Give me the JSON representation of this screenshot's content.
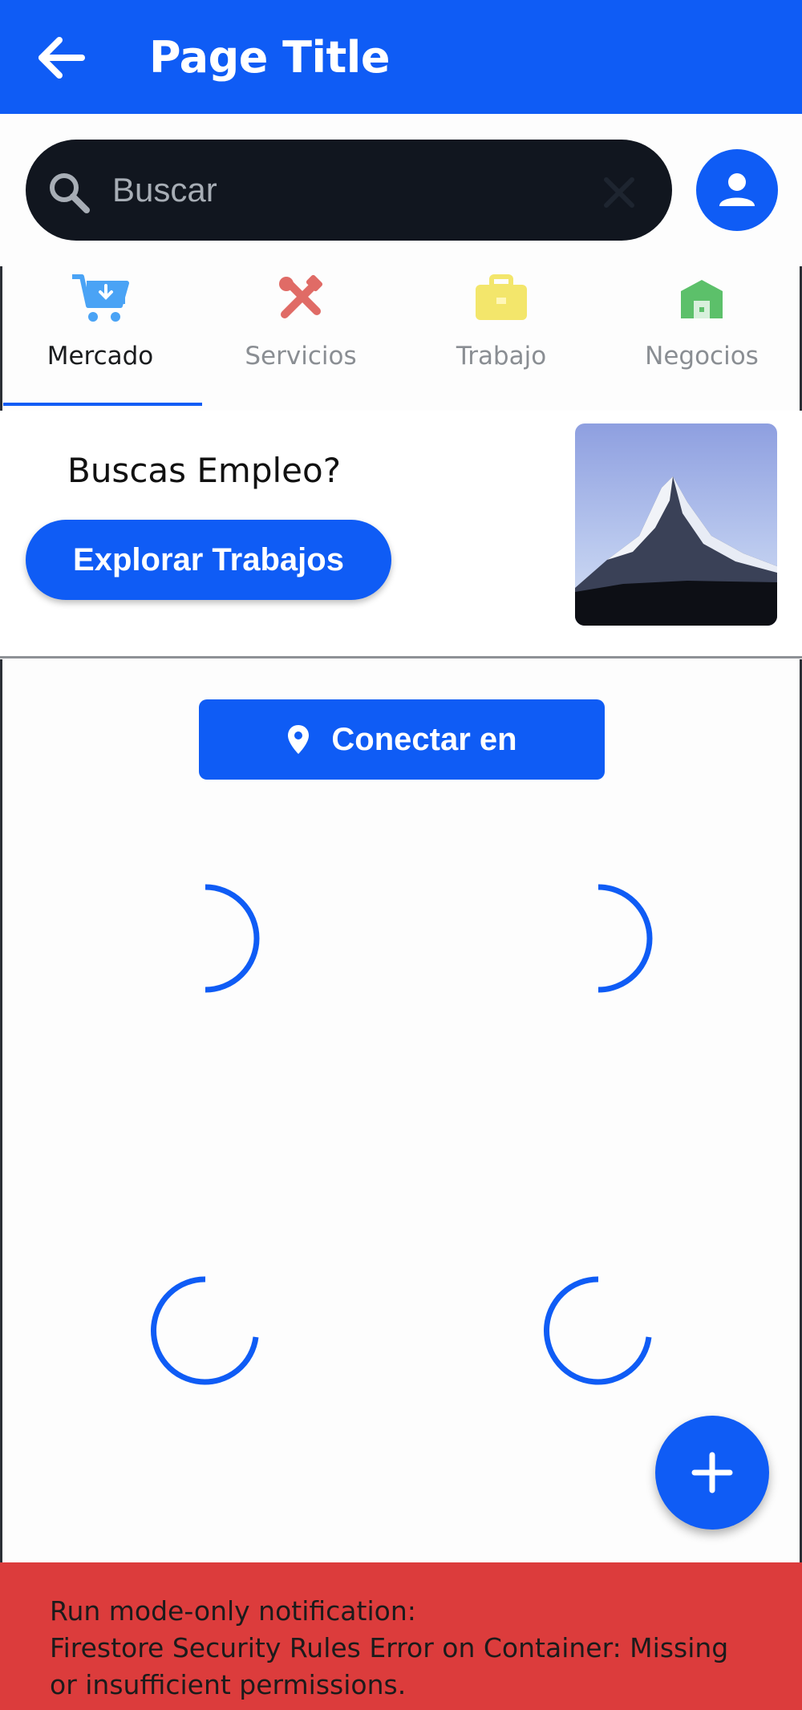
{
  "app_bar": {
    "title": "Page Title",
    "back_icon": "arrow-back-icon",
    "background_color": "#0f5cf5"
  },
  "search": {
    "placeholder": "Buscar",
    "value": "",
    "search_icon": "search-icon",
    "clear_icon": "close-icon",
    "profile_icon": "person-icon"
  },
  "tabs": [
    {
      "label": "Mercado",
      "icon": "shopping-cart-icon",
      "icon_color": "#4aa3f5",
      "active": true
    },
    {
      "label": "Servicios",
      "icon": "tools-icon",
      "icon_color": "#e06b66",
      "active": false
    },
    {
      "label": "Trabajo",
      "icon": "briefcase-icon",
      "icon_color": "#f3e66b",
      "active": false
    },
    {
      "label": "Negocios",
      "icon": "store-icon",
      "icon_color": "#5cc06a",
      "active": false
    }
  ],
  "banner": {
    "heading": "Buscas Empleo?",
    "button_label": "Explorar Trabajos",
    "image": "mountain-image"
  },
  "connect": {
    "label": "Conectar en",
    "icon": "location-pin-icon"
  },
  "loading_indicators": 4,
  "fab": {
    "icon": "plus-icon"
  },
  "notification": {
    "line1": "Run mode-only notification:",
    "line2": "Firestore Security Rules Error on Container: Missing or insufficient permissions.",
    "background_color": "#dc3c3c"
  },
  "colors": {
    "accent": "#0f5cf5",
    "search_bg": "#11161f",
    "error": "#dc3c3c"
  }
}
